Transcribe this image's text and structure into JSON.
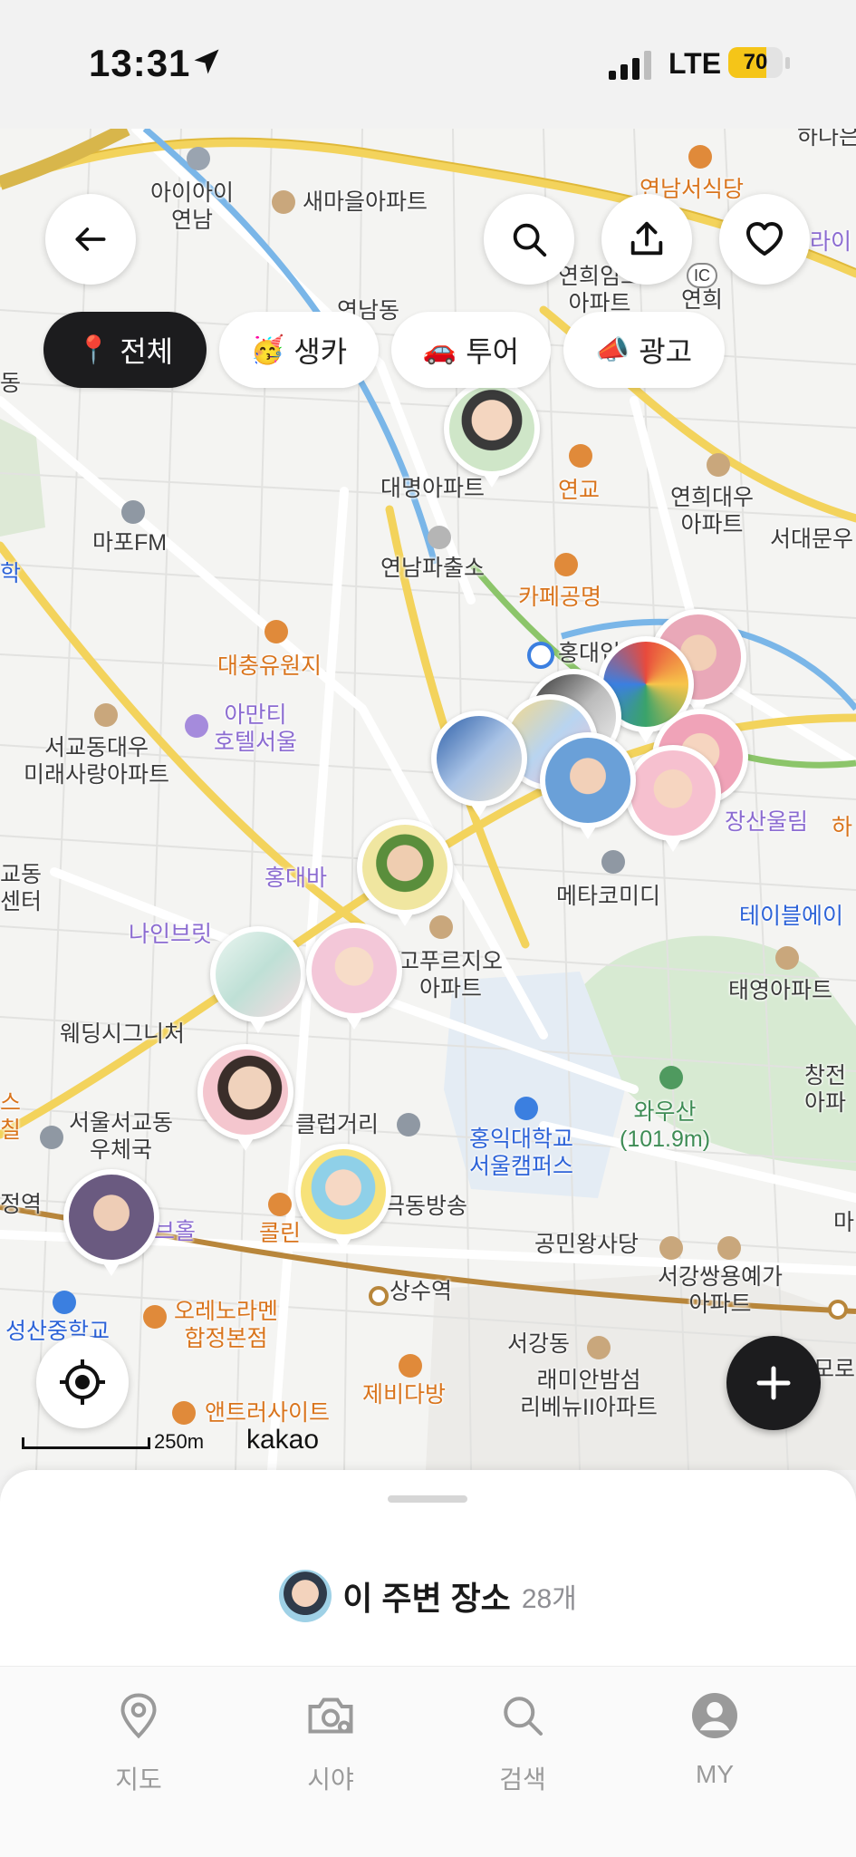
{
  "status_bar": {
    "time": "13:31",
    "network": "LTE",
    "battery": "70",
    "battery_level": 0.7
  },
  "map": {
    "labels": [
      {
        "text": "아이아이\n연남",
        "style": "dark"
      },
      {
        "text": "새마을아파트",
        "style": "dark"
      },
      {
        "text": "연남서식당",
        "style": "orange"
      },
      {
        "text": "연희임오\n아파트",
        "style": "dark"
      },
      {
        "text": "연남동",
        "style": "dark"
      },
      {
        "text": "대명아파트",
        "style": "dark"
      },
      {
        "text": "연교",
        "style": "orange"
      },
      {
        "text": "연희대우\n아파트",
        "style": "dark"
      },
      {
        "text": "마포FM",
        "style": "dark"
      },
      {
        "text": "연남파출소",
        "style": "dark"
      },
      {
        "text": "서대문우",
        "style": "dark"
      },
      {
        "text": "카페공명",
        "style": "orange"
      },
      {
        "text": "대충유원지",
        "style": "orange"
      },
      {
        "text": "홍대입",
        "style": "dark"
      },
      {
        "text": "아만티\n호텔서울",
        "style": "purple"
      },
      {
        "text": "서교동대우\n미래사랑아파트",
        "style": "dark"
      },
      {
        "text": "홍대바",
        "style": "purple"
      },
      {
        "text": "교동\n센터",
        "style": "dark"
      },
      {
        "text": "나인브릿",
        "style": "purple"
      },
      {
        "text": "메타코미디",
        "style": "dark"
      },
      {
        "text": "테이블에이",
        "style": "blue"
      },
      {
        "text": "장산울림",
        "style": "purple"
      },
      {
        "text": "고푸르지오\n아파트",
        "style": "dark"
      },
      {
        "text": "태영아파트",
        "style": "dark"
      },
      {
        "text": "웨딩시그니처",
        "style": "dark"
      },
      {
        "text": "와우산\n(101.9m)",
        "style": "green"
      },
      {
        "text": "창전\n아파",
        "style": "dark"
      },
      {
        "text": "서울서교동\n우체국",
        "style": "dark"
      },
      {
        "text": "클럽거리",
        "style": "dark"
      },
      {
        "text": "홍익대학교\n서울캠퍼스",
        "style": "blue"
      },
      {
        "text": "정역",
        "style": "dark"
      },
      {
        "text": "브홀",
        "style": "purple"
      },
      {
        "text": "콜린",
        "style": "orange"
      },
      {
        "text": "극동방송",
        "style": "dark"
      },
      {
        "text": "공민왕사당",
        "style": "dark"
      },
      {
        "text": "서강쌍용예가\n아파트",
        "style": "dark"
      },
      {
        "text": "상수역",
        "style": "dark"
      },
      {
        "text": "성산중학교",
        "style": "blue"
      },
      {
        "text": "오레노라멘\n합정본점",
        "style": "orange"
      },
      {
        "text": "서강동",
        "style": "dark"
      },
      {
        "text": "래미안밤섬\n리베뉴II아파트",
        "style": "dark"
      },
      {
        "text": "제비다방",
        "style": "orange"
      },
      {
        "text": "앤트러사이트",
        "style": "orange"
      },
      {
        "text": "모로",
        "style": "dark"
      },
      {
        "text": "하",
        "style": "orange"
      },
      {
        "text": "라이",
        "style": "purple"
      },
      {
        "text": "동",
        "style": "dark"
      },
      {
        "text": "학",
        "style": "blue"
      },
      {
        "text": "스\n칠",
        "style": "orange"
      },
      {
        "text": "마",
        "style": "dark"
      },
      {
        "text": "하나은",
        "style": "dark"
      },
      {
        "text": "연희",
        "style": "dark"
      },
      {
        "text": "IC",
        "style": "dark"
      }
    ],
    "scale_label": "250m",
    "provider": "kakao"
  },
  "filters": [
    {
      "emoji": "📍",
      "label": "전체",
      "active": true
    },
    {
      "emoji": "🥳",
      "label": "생카",
      "active": false
    },
    {
      "emoji": "🚗",
      "label": "투어",
      "active": false
    },
    {
      "emoji": "📣",
      "label": "광고",
      "active": false
    }
  ],
  "sheet": {
    "title": "이 주변 장소",
    "count": "28개"
  },
  "tabs": [
    {
      "label": "지도",
      "icon": "map-pin-icon"
    },
    {
      "label": "시야",
      "icon": "camera-icon"
    },
    {
      "label": "검색",
      "icon": "search-icon"
    },
    {
      "label": "MY",
      "icon": "profile-icon"
    }
  ],
  "colors": {
    "accent_dark": "#1c1c1e",
    "battery": "#f5c518",
    "road_yellow": "#f3d35c",
    "road_blue": "#7ab6e8"
  }
}
